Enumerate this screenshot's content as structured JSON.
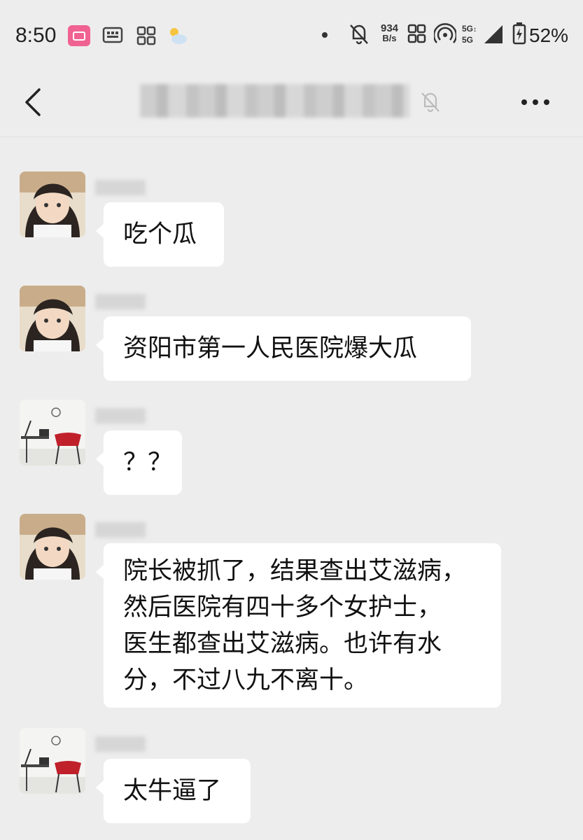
{
  "status_bar": {
    "time": "8:50",
    "net_speed_value": "934",
    "net_speed_unit": "B/s",
    "network_top": "5G",
    "network_bottom": "5G",
    "battery": "52%"
  },
  "header": {
    "back_icon": "chevron-left-icon",
    "mute_icon": "bell-off-icon",
    "more_icon": "more-dots-icon"
  },
  "messages": [
    {
      "avatar": "girl-avatar",
      "text": "吃个瓜"
    },
    {
      "avatar": "girl-avatar",
      "text": "资阳市第一人民医院爆大瓜"
    },
    {
      "avatar": "room-chair-avatar",
      "text": "？？"
    },
    {
      "avatar": "girl-avatar",
      "text": "院长被抓了，结果查出艾滋病，\n然后医院有四十多个女护士，\n医生都查出艾滋病。也许有水\n分，不过八九不离十。"
    },
    {
      "avatar": "room-chair-avatar",
      "text": "太牛逼了"
    }
  ],
  "colors": {
    "background": "#ededed",
    "bubble": "#ffffff",
    "text": "#111111"
  }
}
